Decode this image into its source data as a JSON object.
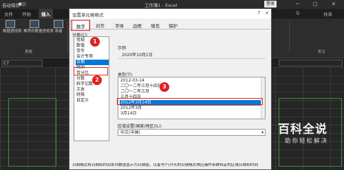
{
  "excel": {
    "autosave_label": "自动保存",
    "workbook_title": "工作簿1 - Excel",
    "login_label": "登录",
    "window_controls": [
      "minimize-icon",
      "restore-icon",
      "close-icon"
    ],
    "tabs": [
      "文件",
      "开始",
      "插入"
    ],
    "active_tab": "插入",
    "right_tabs": [
      "Q",
      "共享"
    ],
    "ribbon_buttons": [
      "数据透视表",
      "推荐的数据透视表",
      "表格"
    ],
    "group_left": "表格",
    "group_right": "批注",
    "name_box": "C7"
  },
  "dialog": {
    "title": "设置单元格格式",
    "help_label": "?",
    "close_label": "×",
    "tabs": [
      "数字",
      "对齐",
      "字体",
      "边框",
      "填充",
      "保护"
    ],
    "selected_tab": "数字",
    "category_label": "分类(C):",
    "categories": [
      "常规",
      "数值",
      "货币",
      "会计专用",
      "日期",
      "时间",
      "百分比",
      "分数",
      "科学记数",
      "文本",
      "特殊",
      "自定义"
    ],
    "selected_category": "日期",
    "sample_label": "示例",
    "sample_value": "2020年10月1日",
    "type_label": "类型(T):",
    "types": [
      "2012-03-14",
      "二〇一二年三月十四日",
      "二〇一二年三月",
      "三月十四日",
      "2012年3月14日",
      "2012年3月",
      "3月14日"
    ],
    "selected_type": "2012年3月14日",
    "locale_label": "区域设置(国家/地区)(L):",
    "locale_value": "中文(中国)",
    "description": "日期格式将日期和时间系列数值显示为日期值。以星号(*)开头的日期格式响应操作系统特定的区域日期和时间"
  },
  "annotations": {
    "steps": [
      "1",
      "2",
      "3"
    ],
    "highlight_color": "#e02020"
  },
  "watermark": {
    "title": "百科全说",
    "subtitle": "助你轻松解决"
  },
  "colors": {
    "selection": "#0078d7",
    "excel_green_border": "#3b8f3b"
  }
}
